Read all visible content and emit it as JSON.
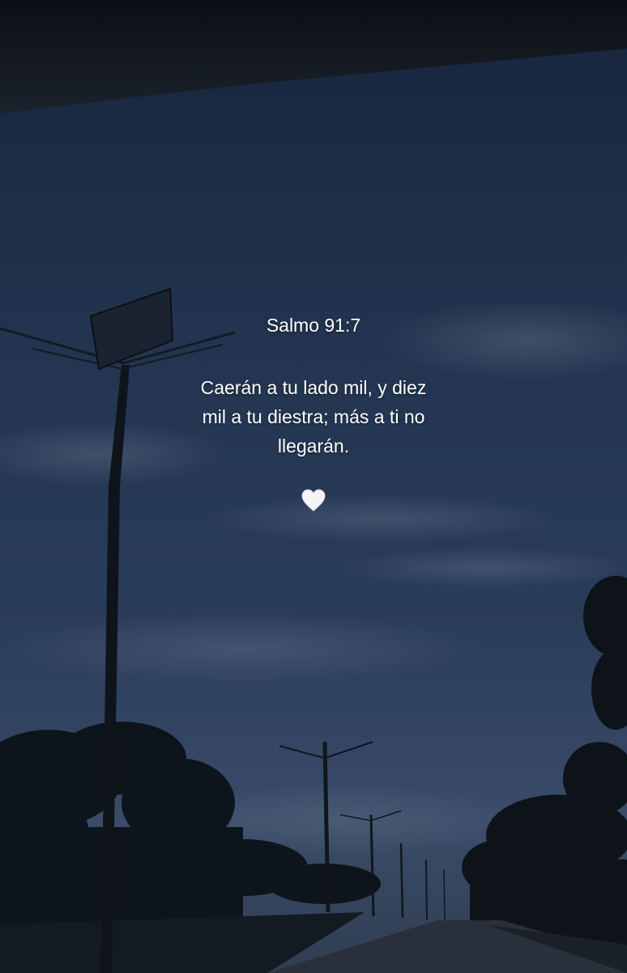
{
  "overlay": {
    "reference": "Salmo 91:7",
    "verse_lines": [
      "Caerán a tu lado mil, y diez",
      "mil a tu diestra; más a ti no",
      "llegarán."
    ],
    "emoji": "white-heart-icon"
  },
  "colors": {
    "sky_top": "#1a2a45",
    "sky_mid": "#263a58",
    "sky_bottom": "#3a4d68",
    "car_roof": "#101418",
    "silhouette": "#0d1218",
    "road": "#2b3140",
    "text": "#ffffff"
  }
}
